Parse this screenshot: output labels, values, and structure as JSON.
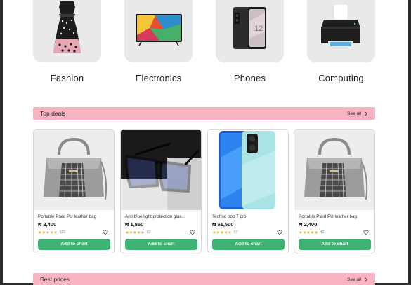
{
  "categories": [
    {
      "label": "Fashion",
      "icon": "dress-icon"
    },
    {
      "label": "Electronics",
      "icon": "tv-icon"
    },
    {
      "label": "Phones",
      "icon": "smartphone-icon"
    },
    {
      "label": "Computing",
      "icon": "printer-icon"
    }
  ],
  "top_deals": {
    "title": "Top deals",
    "see_all": "See all"
  },
  "best_prices": {
    "title": "Best prices",
    "see_all": "See all"
  },
  "products": [
    {
      "name": "Portable Plaid PU leather bag",
      "price": "₦ 2,400",
      "stars": "★★★★★",
      "reviews": "523",
      "button": "Add to chart",
      "image": "handbag-image"
    },
    {
      "name": "Anti blue light protection glas...",
      "price": "₦ 1,850",
      "stars": "★★★★★",
      "reviews": "63",
      "button": "Add to chart",
      "image": "glasses-image"
    },
    {
      "name": "Techno pop 7 pro",
      "price": "₦ 61,500",
      "stars": "★★★★★",
      "reviews": "57",
      "button": "Add to chart",
      "image": "phone-image"
    },
    {
      "name": "Portable Plaid PU leather bag",
      "price": "₦ 2,400",
      "stars": "★★★★★",
      "reviews": "421",
      "button": "Add to chart",
      "image": "handbag-image"
    }
  ],
  "colors": {
    "section_bar": "#f9b4c4",
    "button": "#3fb276",
    "star": "#f2b01e",
    "category_tile": "#e9e9ea"
  }
}
